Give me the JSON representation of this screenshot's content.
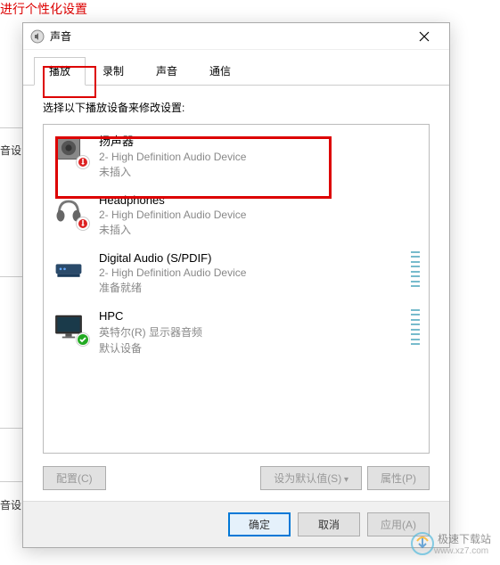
{
  "background": {
    "topText": "进行个性化设置",
    "label1": "音设",
    "label2": "音设"
  },
  "dialog": {
    "title": "声音",
    "tabs": [
      {
        "label": "播放",
        "active": true
      },
      {
        "label": "录制",
        "active": false
      },
      {
        "label": "声音",
        "active": false
      },
      {
        "label": "通信",
        "active": false
      }
    ],
    "instruction": "选择以下播放设备来修改设置:",
    "devices": [
      {
        "name": "扬声器",
        "desc": "2- High Definition Audio Device",
        "status": "未插入",
        "icon": "speaker",
        "badge": "error",
        "meter": false
      },
      {
        "name": "Headphones",
        "desc": "2- High Definition Audio Device",
        "status": "未插入",
        "icon": "headphones",
        "badge": "error",
        "meter": false
      },
      {
        "name": "Digital Audio (S/PDIF)",
        "desc": "2- High Definition Audio Device",
        "status": "准备就绪",
        "icon": "digital",
        "badge": "none",
        "meter": true
      },
      {
        "name": "HPC",
        "desc": "英特尔(R) 显示器音频",
        "status": "默认设备",
        "icon": "monitor",
        "badge": "ok",
        "meter": true
      }
    ],
    "buttons": {
      "configure": "配置(C)",
      "setDefault": "设为默认值(S)",
      "properties": "属性(P)",
      "ok": "确定",
      "cancel": "取消",
      "apply": "应用(A)"
    }
  },
  "watermark": {
    "name": "极速下载站",
    "url": "www.xz7.com"
  }
}
